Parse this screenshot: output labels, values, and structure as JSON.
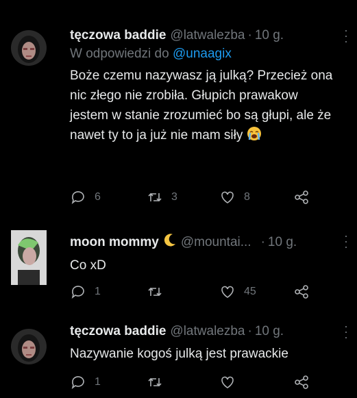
{
  "tweets": [
    {
      "name": "tęczowa baddie",
      "handle": "@latwalezba",
      "dot": "·",
      "time": "10 g.",
      "reply_prefix": "W odpowiedzi do",
      "reply_to": "@unaagix",
      "text": "Boże czemu nazywasz ją julką? Przecież ona nic złego nie zrobiła. Głupich prawakow jestem w stanie zrozumieć bo są głupi, ale że nawet ty to ja już nie mam siły",
      "emoji": "loudly-crying-face",
      "replies": "6",
      "retweets": "3",
      "likes": "8"
    },
    {
      "name": "moon mommy",
      "name_emoji": "crescent-moon",
      "handle": "@mountai...",
      "dot": "·",
      "time": "10 g.",
      "text": "Co xD",
      "replies": "1",
      "retweets": "",
      "likes": "45"
    },
    {
      "name": "tęczowa baddie",
      "handle": "@latwalezba",
      "dot": "·",
      "time": "10 g.",
      "text": "Nazywanie kogoś julką jest prawackie",
      "replies": "1",
      "retweets": "",
      "likes": ""
    }
  ],
  "colors": {
    "background": "#000000",
    "text": "#e7e9ea",
    "muted": "#71767b",
    "link": "#1d9bf0"
  }
}
